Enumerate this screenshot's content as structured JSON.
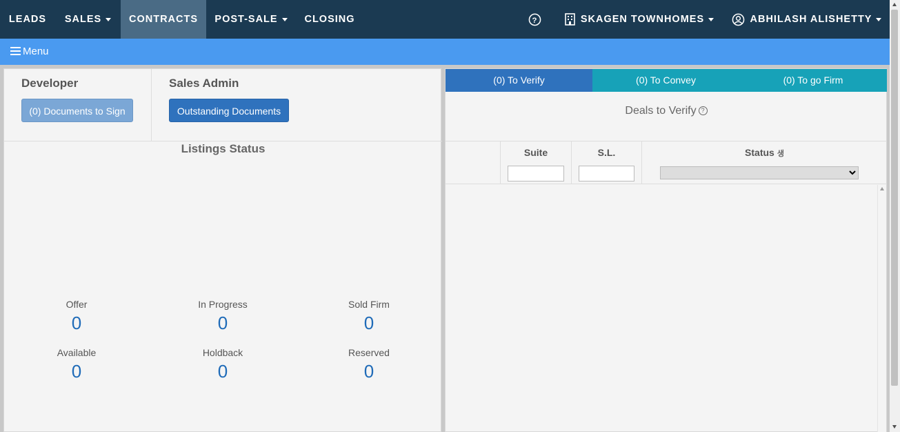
{
  "nav": {
    "leads": "LEADS",
    "sales": "SALES",
    "contracts": "CONTRACTS",
    "post_sale": "POST-SALE",
    "closing": "CLOSING",
    "help_icon": "question-circle",
    "project": "SKAGEN TOWNHOMES",
    "user": "ABHILASH ALISHETTY"
  },
  "menubar": {
    "label": "Menu"
  },
  "developer": {
    "title": "Developer",
    "button": "(0) Documents to Sign"
  },
  "sales_admin": {
    "title": "Sales Admin",
    "button": "Outstanding Documents"
  },
  "listings": {
    "title": "Listings Status",
    "stats": [
      {
        "label": "Offer",
        "value": "0"
      },
      {
        "label": "In Progress",
        "value": "0"
      },
      {
        "label": "Sold Firm",
        "value": "0"
      },
      {
        "label": "Available",
        "value": "0"
      },
      {
        "label": "Holdback",
        "value": "0"
      },
      {
        "label": "Reserved",
        "value": "0"
      }
    ]
  },
  "deals": {
    "tabs": [
      "(0) To Verify",
      "(0) To Convey",
      "(0) To go Firm"
    ],
    "title": "Deals to Verify",
    "columns": [
      "Suite",
      "S.L.",
      "Status"
    ],
    "sort_glyph": "생",
    "status_selected": ""
  },
  "colors": {
    "nav_bg": "#1b3a52",
    "nav_active": "#4a6b85",
    "menubar": "#4a9af0",
    "primary": "#2f72bd",
    "info": "#17a2b8",
    "stat_value": "#1f6bb8"
  }
}
